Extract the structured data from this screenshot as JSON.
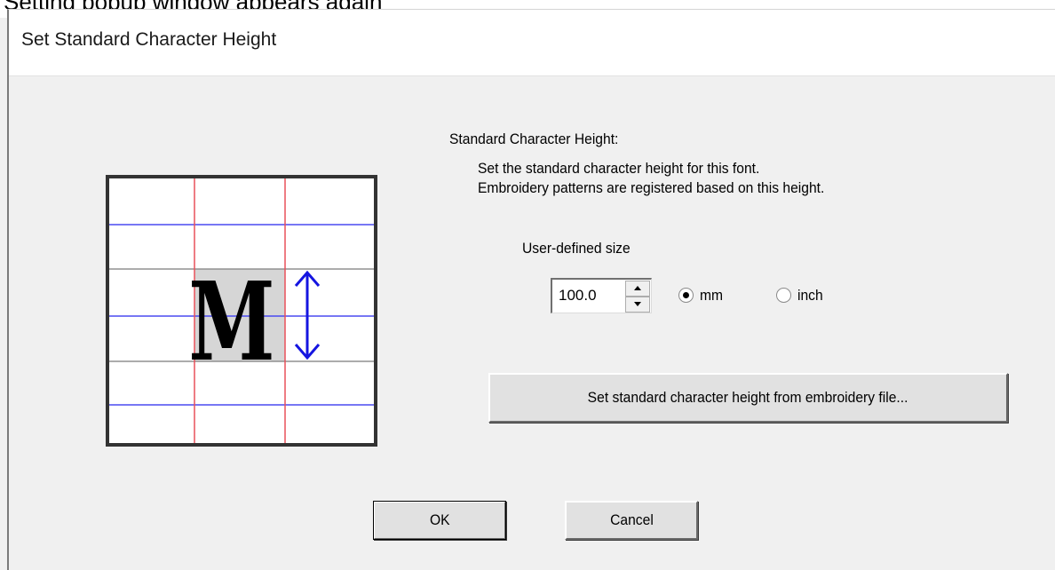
{
  "top_strip": {
    "text": "Setting popup window appears again"
  },
  "dialog": {
    "title": "Set Standard Character Height",
    "heading": "Standard Character Height:",
    "description_line1": "Set the standard character height for this font.",
    "description_line2": "Embroidery patterns are registered based on this height.",
    "size_label": "User-defined size",
    "size_value": "100.0",
    "units": {
      "selected": "mm",
      "options": [
        {
          "label": "mm",
          "selected": true
        },
        {
          "label": "inch",
          "selected": false
        }
      ]
    },
    "from_file_button": "Set standard character height from embroidery file...",
    "ok_button": "OK",
    "cancel_button": "Cancel"
  },
  "illustration": {
    "letter": "M",
    "colors": {
      "blue_lines": "#4a4af0",
      "red_lines": "#e8505a",
      "gray_lines": "#909090",
      "arrow": "#1515e0",
      "highlight": "#d6d6d6"
    }
  }
}
